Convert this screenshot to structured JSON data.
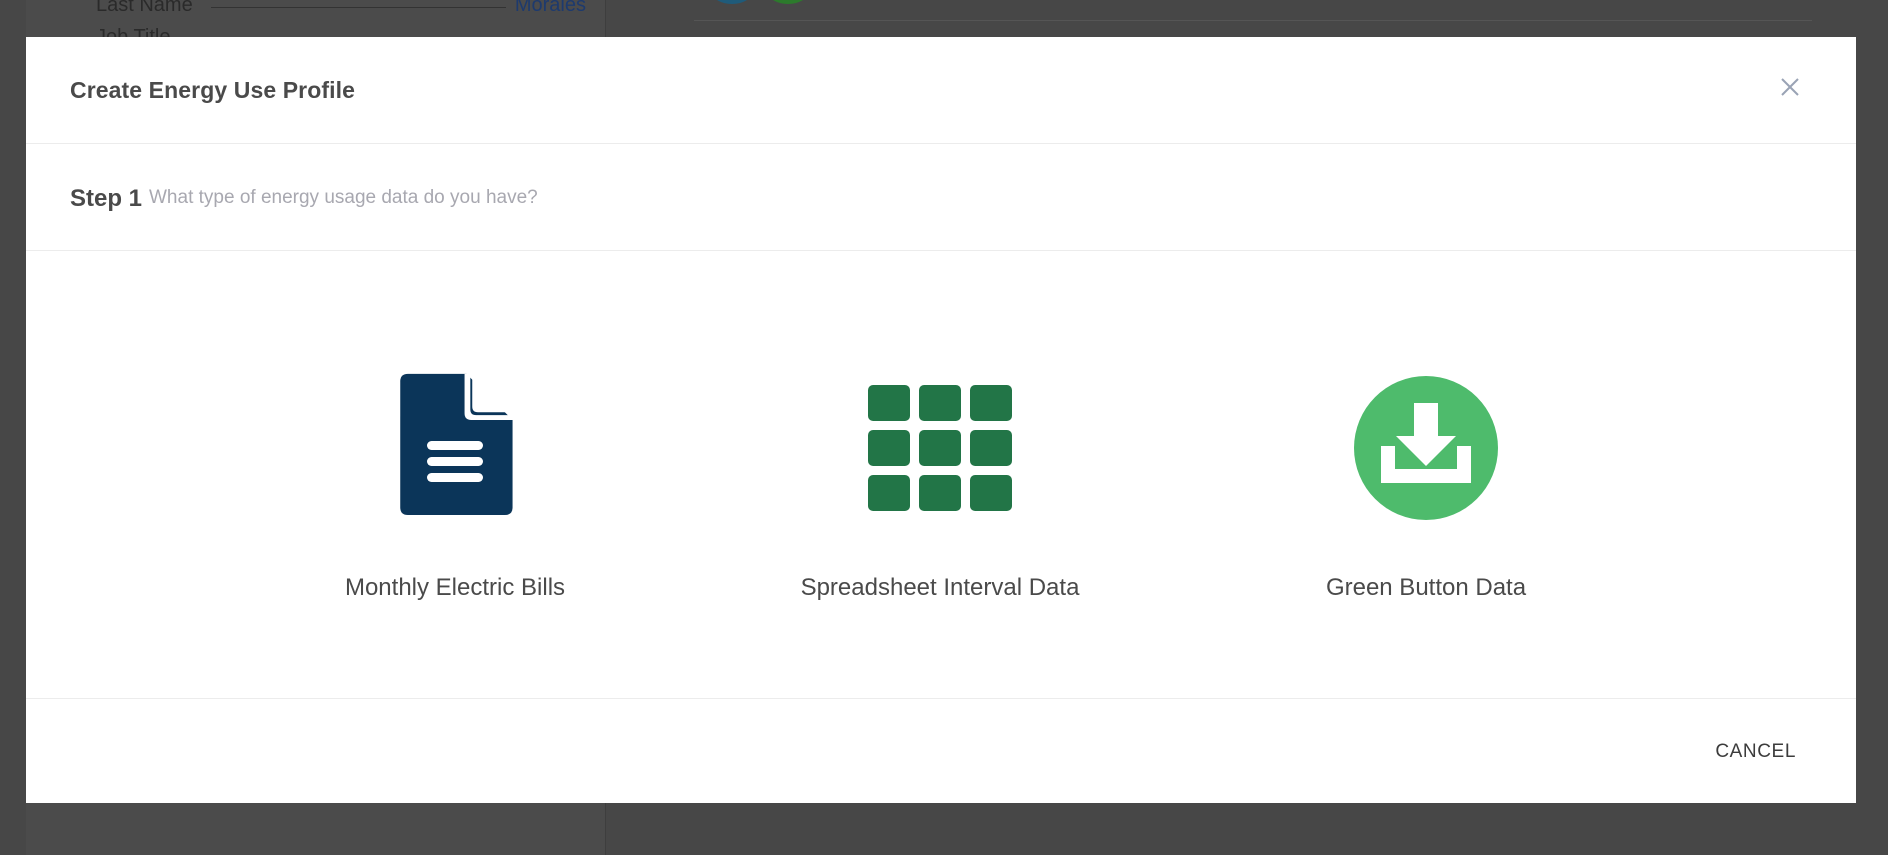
{
  "background": {
    "last_name_label": "Last Name",
    "last_name_value": "Morales",
    "job_title_label": "Job Title"
  },
  "modal": {
    "title": "Create Energy Use Profile",
    "close_icon": "close-icon",
    "step": {
      "label": "Step 1",
      "hint": "What type of energy usage data do you have?"
    },
    "options": [
      {
        "label": "Monthly Electric Bills",
        "icon": "document-icon",
        "color": "#0b3559"
      },
      {
        "label": "Spreadsheet Interval Data",
        "icon": "grid-icon",
        "color": "#227547"
      },
      {
        "label": "Green Button Data",
        "icon": "download-icon",
        "color": "#4ebb6c"
      }
    ],
    "cancel_label": "CANCEL"
  }
}
